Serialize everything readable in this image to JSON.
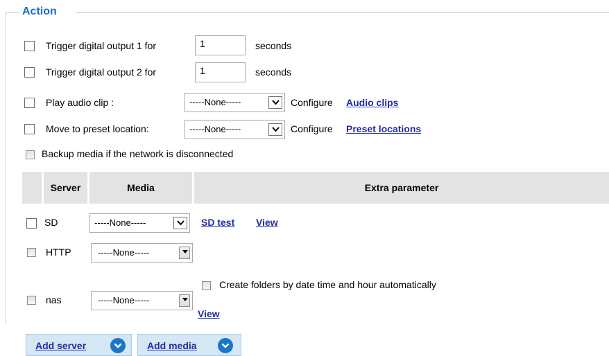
{
  "legend": "Action",
  "actions": {
    "do1": {
      "prefix": "Trigger digital output 1 for",
      "value": "1",
      "suffix": "seconds"
    },
    "do2": {
      "prefix": "Trigger digital output 2 for",
      "value": "1",
      "suffix": "seconds"
    },
    "audio": {
      "label": "Play audio clip :",
      "selected": "-----None-----",
      "configure": "Configure",
      "link": "Audio clips"
    },
    "preset": {
      "label": "Move to preset location:",
      "selected": "-----None-----",
      "configure": "Configure",
      "link": "Preset locations"
    },
    "backup": {
      "label": "Backup media if the network is disconnected"
    }
  },
  "table": {
    "headers": {
      "server": "Server",
      "media": "Media",
      "extra": "Extra parameter"
    },
    "rows": {
      "sd": {
        "server": "SD",
        "media": "-----None-----",
        "link1": "SD test",
        "link2": "View"
      },
      "http": {
        "server": "HTTP",
        "media": "-----None-----"
      },
      "nas": {
        "server": "nas",
        "media": "-----None-----",
        "extra_checkbox": "Create folders by date time and hour automatically",
        "link": "View"
      }
    }
  },
  "buttons": {
    "add_server": "Add server",
    "add_media": "Add media"
  },
  "colors": {
    "legend": "#1a6fc2",
    "link": "#1f2fa0",
    "button_bg": "#d5e7f5",
    "circle_icon": "#1a77c7",
    "header_bg": "#e3e3e3"
  },
  "icons": {
    "dropdown": "chevron-down-icon",
    "add": "circle-chevron-down-icon"
  }
}
